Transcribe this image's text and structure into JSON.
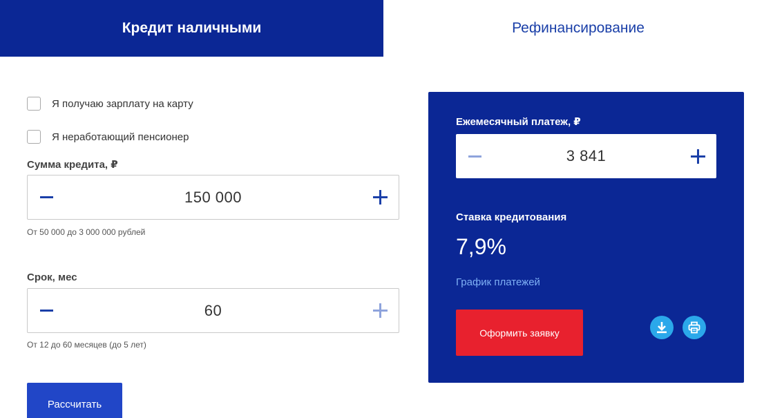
{
  "tabs": [
    {
      "label": "Кредит наличными",
      "active": true
    },
    {
      "label": "Рефинансирование",
      "active": false
    }
  ],
  "options": {
    "salary_card": "Я получаю зарплату на карту",
    "pensioner": "Я неработающий пенсионер"
  },
  "amount": {
    "label": "Сумма кредита, ₽",
    "value": "150 000",
    "hint": "От 50 000 до 3 000 000 рублей"
  },
  "term": {
    "label": "Срок, мес",
    "value": "60",
    "hint": "От 12 до 60 месяцев (до 5 лет)"
  },
  "calculate_label": "Рассчитать",
  "result": {
    "payment_label": "Ежемесячный платеж, ₽",
    "payment_value": "3 841",
    "rate_label": "Ставка кредитования",
    "rate_value": "7,9%",
    "schedule_link": "График платежей",
    "apply_label": "Оформить заявку"
  },
  "colors": {
    "brand_blue": "#0b2795",
    "accent_red": "#e8212e",
    "icon_cyan": "#2ba8ea"
  },
  "icons": [
    "minus-icon",
    "plus-icon",
    "download-icon",
    "print-icon"
  ]
}
